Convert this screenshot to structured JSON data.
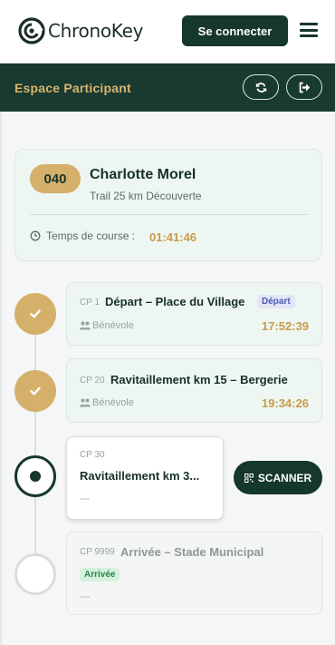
{
  "header": {
    "brand": "ChronoKey",
    "connect_label": "Se connecter",
    "icons": {
      "logo": "chronokey-logo-icon",
      "menu": "hamburger-menu-icon"
    }
  },
  "space": {
    "title": "Espace Participant",
    "icons": {
      "refresh": "refresh-icon",
      "logout": "sign-out-icon"
    }
  },
  "participant": {
    "bib": "040",
    "name": "Charlotte Morel",
    "race": "Trail 25 km Découverte",
    "race_time_label": "Temps de course :",
    "race_time": "01:41:46"
  },
  "checkpoints": [
    {
      "id": "CP 1",
      "title": "Départ – Place du Village",
      "badge": "Départ",
      "volunteer": "Bénévole",
      "time": "17:52:39",
      "status": "done"
    },
    {
      "id": "CP 20",
      "title": "Ravitaillement km 15 – Bergerie",
      "volunteer": "Bénévole",
      "time": "19:34:26",
      "status": "done"
    },
    {
      "id": "CP 30",
      "title": "Ravitaillement km 3...",
      "placeholder": "---",
      "status": "current"
    },
    {
      "id": "CP 9999",
      "title": "Arrivée – Stade Municipal",
      "badge": "Arrivée",
      "placeholder": "---",
      "status": "future"
    }
  ],
  "scan_label": "SCANNER",
  "colors": {
    "primary": "#16372d",
    "gold": "#d5b06a",
    "time": "#c99b4b"
  }
}
